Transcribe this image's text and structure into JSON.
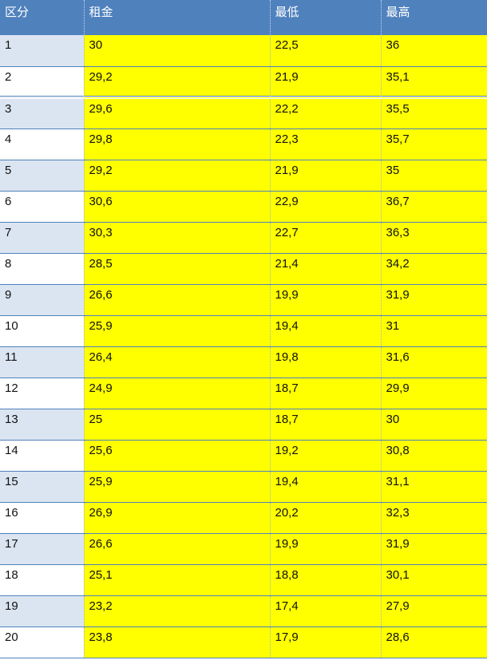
{
  "headers": [
    "区分",
    "租金",
    "最低",
    "最高"
  ],
  "rows": [
    {
      "id": "1",
      "rent": "30",
      "min": "22,5",
      "max": "36"
    },
    {
      "id": "2",
      "rent": "29,2",
      "min": "21,9",
      "max": "35,1"
    },
    {
      "id": "3",
      "rent": "29,6",
      "min": "22,2",
      "max": "35,5"
    },
    {
      "id": "4",
      "rent": "29,8",
      "min": "22,3",
      "max": "35,7"
    },
    {
      "id": "5",
      "rent": "29,2",
      "min": "21,9",
      "max": "35"
    },
    {
      "id": "6",
      "rent": "30,6",
      "min": "22,9",
      "max": "36,7"
    },
    {
      "id": "7",
      "rent": "30,3",
      "min": "22,7",
      "max": "36,3"
    },
    {
      "id": "8",
      "rent": "28,5",
      "min": "21,4",
      "max": "34,2"
    },
    {
      "id": "9",
      "rent": "26,6",
      "min": "19,9",
      "max": "31,9"
    },
    {
      "id": "10",
      "rent": "25,9",
      "min": "19,4",
      "max": "31"
    },
    {
      "id": "11",
      "rent": "26,4",
      "min": "19,8",
      "max": "31,6"
    },
    {
      "id": "12",
      "rent": "24,9",
      "min": "18,7",
      "max": "29,9"
    },
    {
      "id": "13",
      "rent": "25",
      "min": "18,7",
      "max": "30"
    },
    {
      "id": "14",
      "rent": "25,6",
      "min": "19,2",
      "max": "30,8"
    },
    {
      "id": "15",
      "rent": "25,9",
      "min": "19,4",
      "max": "31,1"
    },
    {
      "id": "16",
      "rent": "26,9",
      "min": "20,2",
      "max": "32,3"
    },
    {
      "id": "17",
      "rent": "26,6",
      "min": "19,9",
      "max": "31,9"
    },
    {
      "id": "18",
      "rent": "25,1",
      "min": "18,8",
      "max": "30,1"
    },
    {
      "id": "19",
      "rent": "23,2",
      "min": "17,4",
      "max": "27,9"
    },
    {
      "id": "20",
      "rent": "23,8",
      "min": "17,9",
      "max": "28,6"
    }
  ],
  "colors": {
    "header_bg": "#4f81bd",
    "header_text": "#ffffff",
    "value_cell_bg": "#ffff00",
    "index_band_bg": "#dbe5f1",
    "grid_line": "#4f81bd"
  }
}
